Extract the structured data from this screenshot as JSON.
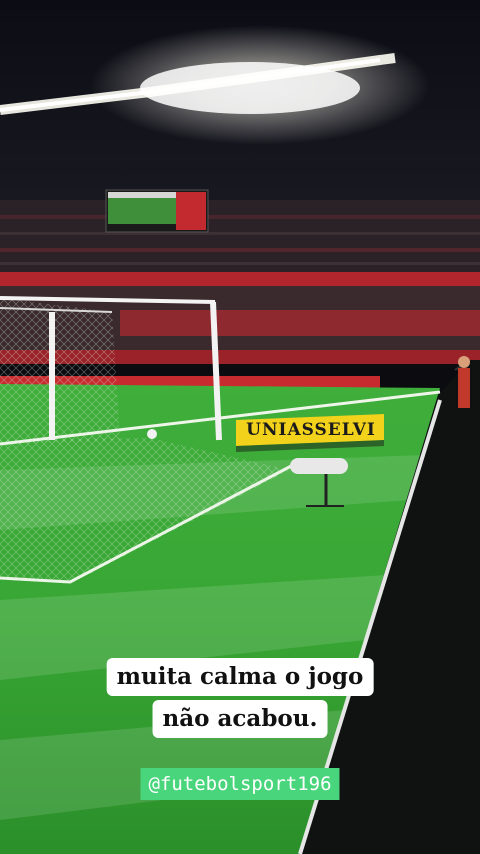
{
  "overlay": {
    "caption_line1": "muita calma o jogo",
    "caption_line2": "não acabou.",
    "handle": "@futebolsport196"
  },
  "scene": {
    "ad_board_text": "UNIASSELVI"
  }
}
